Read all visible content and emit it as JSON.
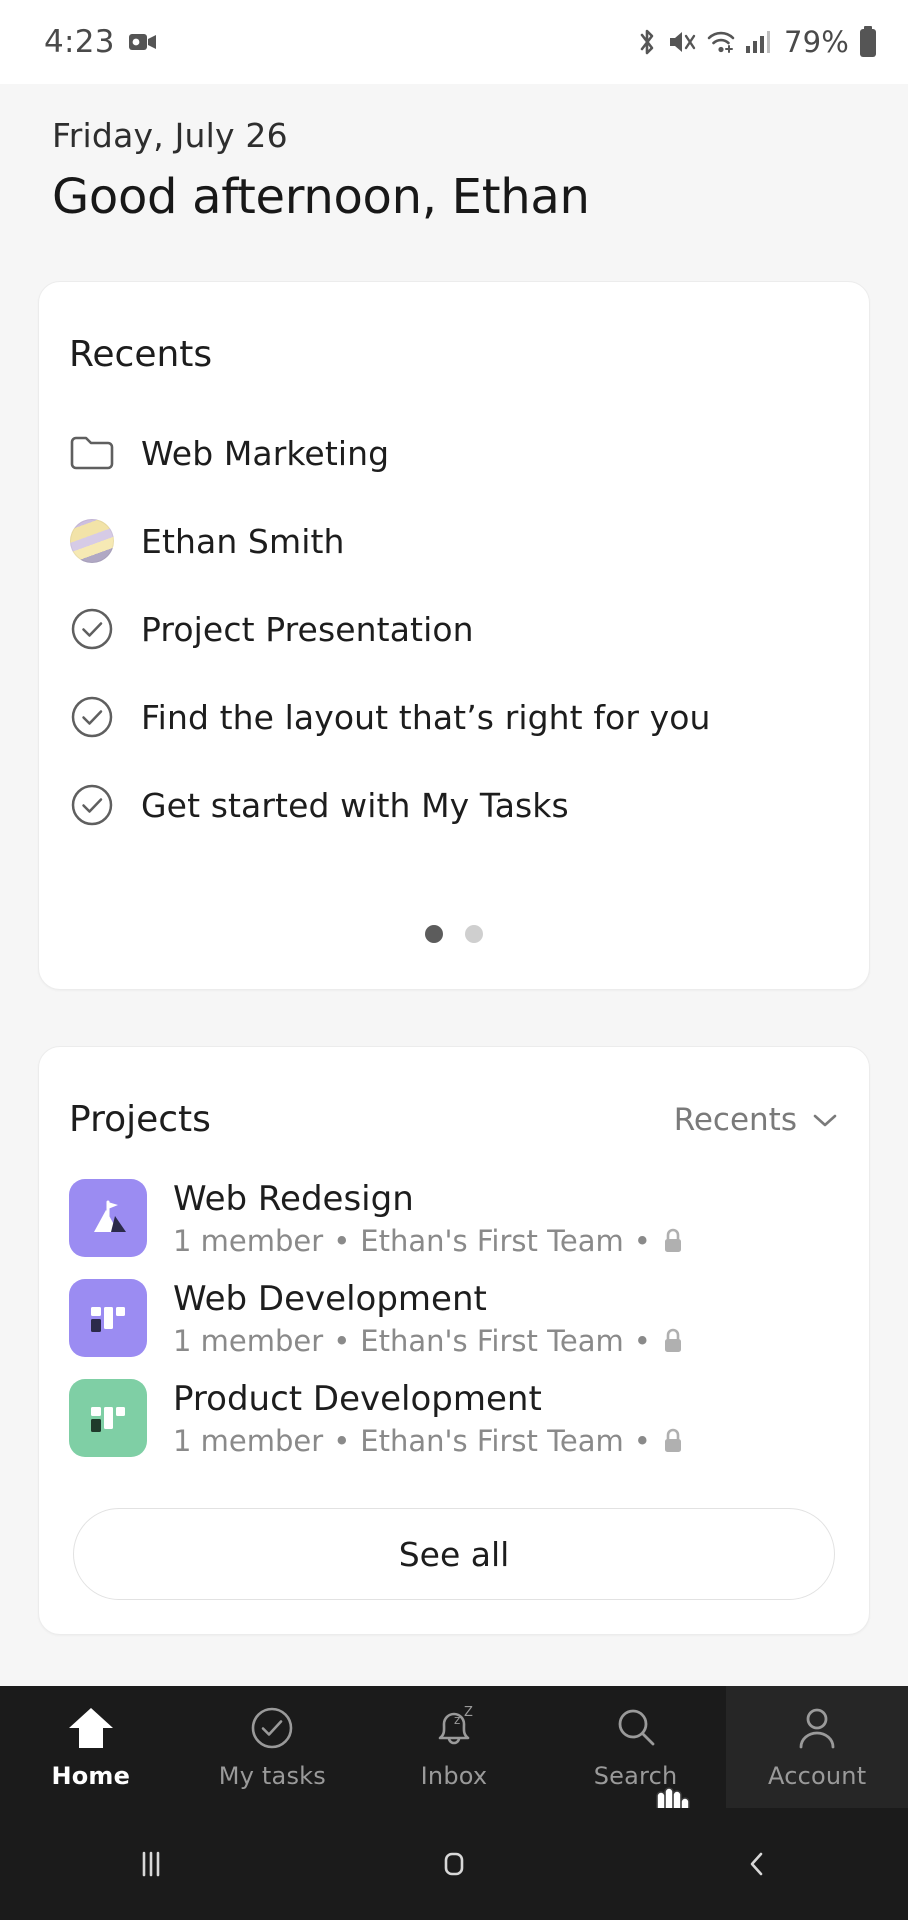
{
  "status_bar": {
    "time": "4:23",
    "battery_percent": "79%",
    "icons": [
      "video-record-icon",
      "bluetooth-icon",
      "mute-icon",
      "wifi-icon",
      "cellular-signal-icon",
      "battery-icon"
    ]
  },
  "header": {
    "date": "Friday, July 26",
    "greeting": "Good afternoon, Ethan"
  },
  "recents_card": {
    "title": "Recents",
    "items": [
      {
        "label": "Web Marketing",
        "icon": "folder-icon"
      },
      {
        "label": "Ethan Smith",
        "icon": "avatar-image"
      },
      {
        "label": "Project Presentation",
        "icon": "check-circle-icon"
      },
      {
        "label": "Find the layout that’s right for you",
        "icon": "check-circle-icon"
      },
      {
        "label": "Get started with My Tasks",
        "icon": "check-circle-icon"
      }
    ],
    "pagination": {
      "total": 2,
      "active_index": 0
    }
  },
  "projects_card": {
    "title": "Projects",
    "sort_label": "Recents",
    "sort_icon": "chevron-down-icon",
    "see_all_label": "See all",
    "items": [
      {
        "name": "Web Redesign",
        "members": "1 member",
        "team": "Ethan's First Team",
        "privacy_icon": "lock-icon",
        "separator": "•",
        "icon": "mountain-flag-icon",
        "color": "#9b8cf2"
      },
      {
        "name": "Web Development",
        "members": "1 member",
        "team": "Ethan's First Team",
        "privacy_icon": "lock-icon",
        "separator": "•",
        "icon": "board-icon",
        "color": "#9b8cf2"
      },
      {
        "name": "Product Development",
        "members": "1 member",
        "team": "Ethan's First Team",
        "privacy_icon": "lock-icon",
        "separator": "•",
        "icon": "board-icon",
        "color": "#7fcfa5"
      }
    ]
  },
  "bottom_nav": {
    "items": [
      {
        "label": "Home",
        "icon": "home-icon",
        "active": true
      },
      {
        "label": "My tasks",
        "icon": "check-circle-icon",
        "active": false
      },
      {
        "label": "Inbox",
        "icon": "bell-snooze-icon",
        "active": false
      },
      {
        "label": "Search",
        "icon": "search-icon",
        "active": false
      },
      {
        "label": "Account",
        "icon": "person-icon",
        "active": false
      }
    ]
  },
  "system_nav": {
    "recents_icon": "recents-icon",
    "home_icon": "home-square-icon",
    "back_icon": "back-chevron-icon"
  },
  "colors": {
    "page_background": "#f6f6f6",
    "card_background": "#ffffff",
    "nav_background": "#1b1b1b",
    "accent_purple": "#9b8cf2",
    "accent_green": "#7fcfa5"
  }
}
